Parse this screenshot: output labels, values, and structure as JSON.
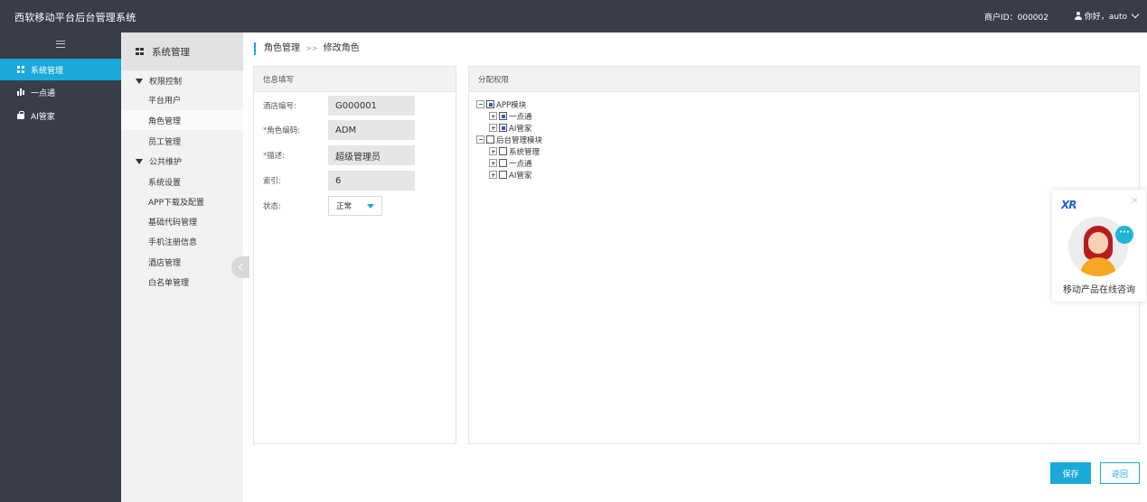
{
  "header": {
    "app_title": "西软移动平台后台管理系统",
    "merchant_id": "商户ID：000002",
    "greeting": "你好，auto"
  },
  "leftnav": {
    "items": [
      {
        "label": "系统管理",
        "icon": "grid-icon",
        "active": true
      },
      {
        "label": "一点通",
        "icon": "bar-chart-icon",
        "active": false
      },
      {
        "label": "AI管家",
        "icon": "bag-icon",
        "active": false
      }
    ]
  },
  "subnav": {
    "title": "系统管理",
    "groups": [
      {
        "label": "权限控制",
        "items": [
          "平台用户",
          "角色管理",
          "员工管理"
        ]
      },
      {
        "label": "公共维护",
        "items": [
          "系统设置",
          "APP下载及配置",
          "基础代码管理",
          "手机注册信息",
          "酒店管理",
          "白名单管理"
        ]
      }
    ],
    "active_item": "角色管理"
  },
  "breadcrumb": {
    "parent": "角色管理",
    "separator": ">>",
    "current": "修改角色"
  },
  "info_panel": {
    "title": "信息填写",
    "fields": [
      {
        "label": "酒店编号:",
        "required": false,
        "value": "G000001"
      },
      {
        "label": "角色编码:",
        "required": true,
        "value": "ADM"
      },
      {
        "label": "描述:",
        "required": true,
        "value": "超级管理员"
      },
      {
        "label": "索引:",
        "required": false,
        "value": "6"
      }
    ],
    "status": {
      "label": "状态:",
      "value": "正常"
    }
  },
  "perm_panel": {
    "title": "分配权限",
    "tree": [
      {
        "label": "APP模块",
        "checked": true,
        "expanded": true,
        "children": [
          {
            "label": "一点通",
            "checked": true
          },
          {
            "label": "AI管家",
            "checked": true
          }
        ]
      },
      {
        "label": "后台管理模块",
        "checked": false,
        "expanded": true,
        "children": [
          {
            "label": "系统管理",
            "checked": false
          },
          {
            "label": "一点通",
            "checked": false
          },
          {
            "label": "AI管家",
            "checked": false
          }
        ]
      }
    ]
  },
  "chat_widget": {
    "logo": "XR",
    "close": "×",
    "bubble": "···",
    "text": "移动产品在线咨询"
  },
  "actions": {
    "save": "保存",
    "back": "返回"
  },
  "colors": {
    "accent": "#1aa9d9",
    "dark_bar": "#393d49",
    "checkbox": "#1f5fd6"
  }
}
